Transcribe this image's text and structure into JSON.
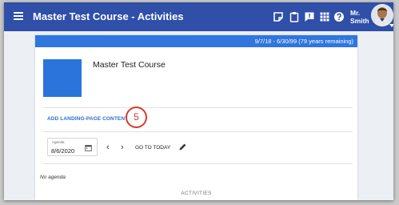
{
  "app": {
    "title": "Master Test Course - Activities"
  },
  "user": {
    "name_line1": "Mr.",
    "name_line2": "Smith"
  },
  "toolbar": {
    "icons": [
      "notes-icon",
      "clipboard-icon",
      "chat-icon",
      "apps-grid-icon",
      "help-icon"
    ]
  },
  "course": {
    "date_range": "9/7/18 - 6/30/99 (79 years remaining)",
    "title": "Master Test Course",
    "thumbnail_color": "#2a74dc"
  },
  "landing": {
    "link_label": "ADD LANDING-PAGE CONTENT"
  },
  "annotation": {
    "step_number": "5"
  },
  "agenda": {
    "caption": "Agenda",
    "date_value": "8/6/2020",
    "prev_label": "‹",
    "next_label": "›",
    "go_today_label": "GO TO TODAY",
    "empty_text": "No agenda"
  },
  "activities": {
    "header": "ACTIVITIES"
  },
  "colors": {
    "appbar": "#2f4fa8",
    "date_bar": "#2f76de",
    "link": "#2b6fd6",
    "badge": "#d73a2a"
  }
}
